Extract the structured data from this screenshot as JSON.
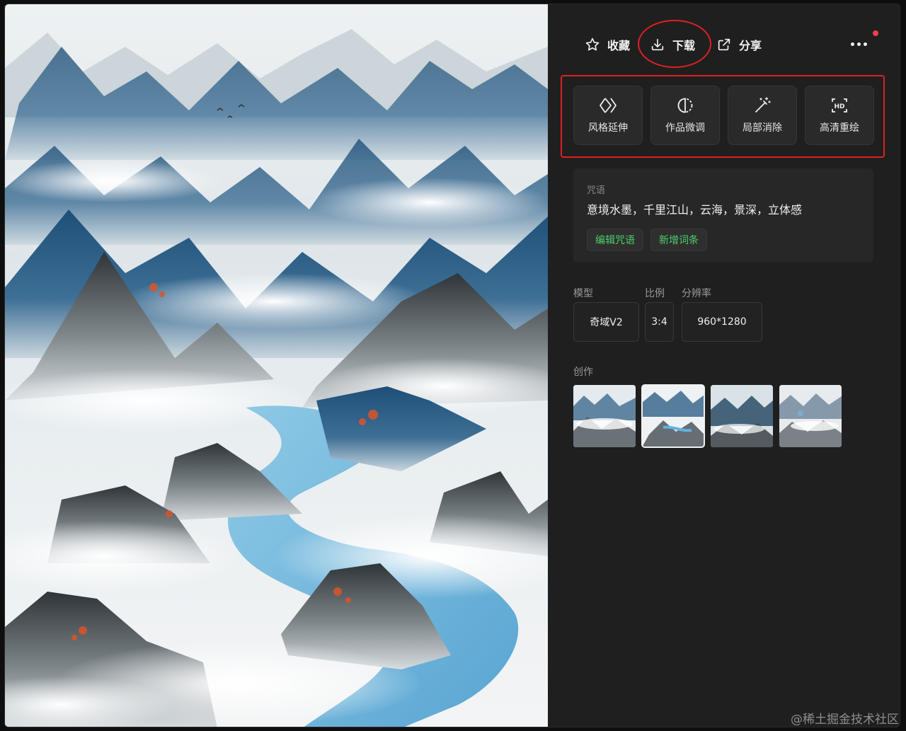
{
  "toolbar": {
    "favorite_label": "收藏",
    "download_label": "下载",
    "share_label": "分享"
  },
  "tools": [
    {
      "label": "风格延伸",
      "icon": "diamond-extend-icon"
    },
    {
      "label": "作品微调",
      "icon": "half-circle-icon"
    },
    {
      "label": "局部消除",
      "icon": "magic-wand-icon"
    },
    {
      "label": "高清重绘",
      "icon": "hd-icon"
    }
  ],
  "prompt": {
    "title": "咒语",
    "text": "意境水墨，千里江山，云海，景深，立体感",
    "edit_label": "编辑咒语",
    "add_label": "新增词条"
  },
  "meta": {
    "model_label": "模型",
    "model_value": "奇域V2",
    "ratio_label": "比例",
    "ratio_value": "3:4",
    "resolution_label": "分辨率",
    "resolution_value": "960*1280"
  },
  "creations": {
    "label": "创作",
    "active_index": 1
  },
  "watermark": "@稀土掘金技术社区",
  "colors": {
    "accent_green": "#4ccf6c",
    "highlight_red": "#e02020",
    "panel_bg": "#1f1f1f"
  }
}
